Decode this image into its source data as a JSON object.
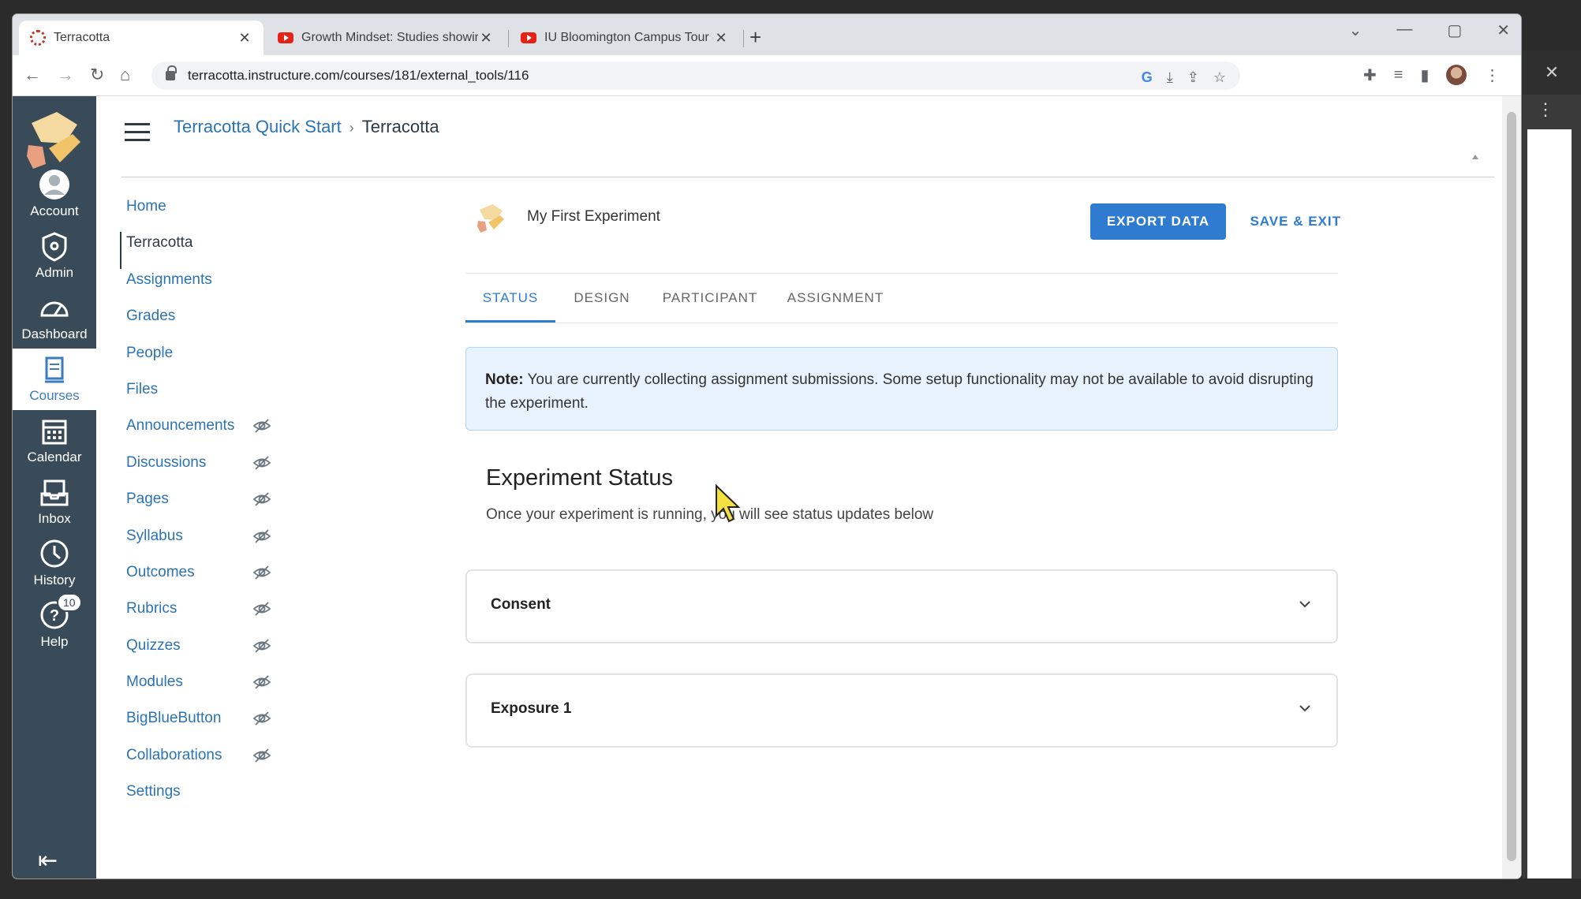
{
  "browser": {
    "tabs": [
      {
        "title": "Terracotta",
        "favicon": "terracotta-favicon",
        "active": true
      },
      {
        "title": "Growth Mindset: Studies showing",
        "favicon": "youtube-favicon",
        "active": false
      },
      {
        "title": "IU Bloomington Campus Tour - Y",
        "favicon": "youtube-favicon",
        "active": false
      }
    ],
    "url": "terracotta.instructure.com/courses/181/external_tools/116"
  },
  "global_nav": {
    "items": [
      {
        "label": "Account",
        "icon": "account-icon"
      },
      {
        "label": "Admin",
        "icon": "admin-icon"
      },
      {
        "label": "Dashboard",
        "icon": "dashboard-icon"
      },
      {
        "label": "Courses",
        "icon": "courses-icon",
        "active": true
      },
      {
        "label": "Calendar",
        "icon": "calendar-icon"
      },
      {
        "label": "Inbox",
        "icon": "inbox-icon"
      },
      {
        "label": "History",
        "icon": "history-icon"
      },
      {
        "label": "Help",
        "icon": "help-icon",
        "badge": "10"
      }
    ]
  },
  "breadcrumb": {
    "course": "Terracotta Quick Start",
    "current": "Terracotta"
  },
  "course_nav": {
    "items": [
      {
        "label": "Home",
        "hidden": false
      },
      {
        "label": "Terracotta",
        "hidden": false,
        "active": true
      },
      {
        "label": "Assignments",
        "hidden": false
      },
      {
        "label": "Grades",
        "hidden": false
      },
      {
        "label": "People",
        "hidden": false
      },
      {
        "label": "Files",
        "hidden": false
      },
      {
        "label": "Announcements",
        "hidden": true
      },
      {
        "label": "Discussions",
        "hidden": true
      },
      {
        "label": "Pages",
        "hidden": true
      },
      {
        "label": "Syllabus",
        "hidden": true
      },
      {
        "label": "Outcomes",
        "hidden": true
      },
      {
        "label": "Rubrics",
        "hidden": true
      },
      {
        "label": "Quizzes",
        "hidden": true
      },
      {
        "label": "Modules",
        "hidden": true
      },
      {
        "label": "BigBlueButton",
        "hidden": true
      },
      {
        "label": "Collaborations",
        "hidden": true
      },
      {
        "label": "Settings",
        "hidden": false
      }
    ]
  },
  "experiment": {
    "title": "My First Experiment",
    "export_label": "EXPORT DATA",
    "save_label": "SAVE & EXIT",
    "tabs": [
      "STATUS",
      "DESIGN",
      "PARTICIPANT",
      "ASSIGNMENT"
    ],
    "active_tab": "STATUS",
    "note_label": "Note:",
    "note_text": " You are currently collecting assignment submissions. Some setup functionality may not be available to avoid disrupting the experiment.",
    "status_title": "Experiment Status",
    "status_subtitle": "Once your experiment is running, you will see status updates below",
    "sections": [
      "Consent",
      "Exposure 1"
    ]
  },
  "colors": {
    "global_nav_bg": "#394b58",
    "link_blue": "#2b73b4",
    "primary_button": "#2f7bcf",
    "note_bg": "#e8f2fc"
  }
}
